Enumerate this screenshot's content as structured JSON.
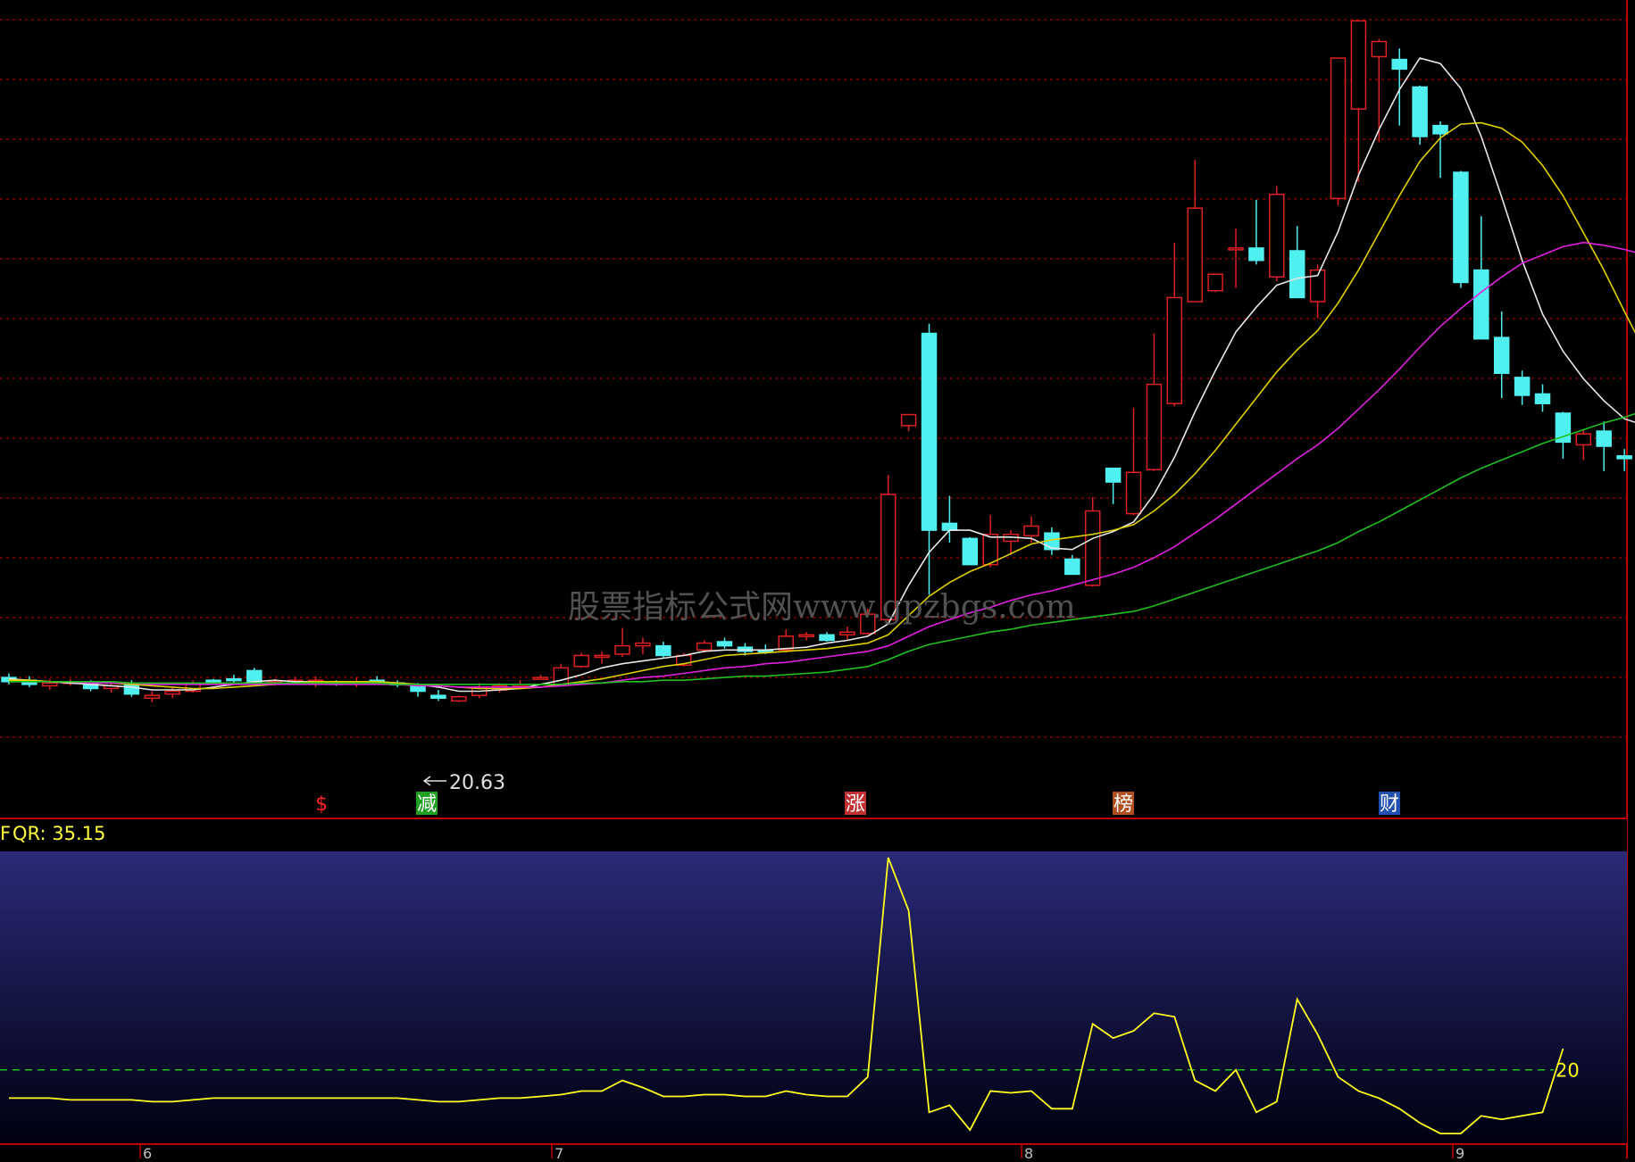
{
  "colors": {
    "background": "#000000",
    "grid": "#a00000",
    "frame": "#c00000",
    "up": "#e02020",
    "down": "#50f0f0",
    "ma_white": "#e8e8e8",
    "ma_yellow": "#e0d000",
    "ma_magenta": "#e020e0",
    "ma_green": "#20c020",
    "qr_line": "#ffff20",
    "qr_ref": "#20c020",
    "panel_top": "#2a2a78",
    "panel_bottom": "#000010"
  },
  "watermark": "股票指标公式网www.gpzbgs.com",
  "price_panel": {
    "low_marker_label": "20.63",
    "event_labels": [
      {
        "text": "$",
        "color": "#ff2020",
        "bg": "#000000"
      },
      {
        "text": "减",
        "color": "#ffffff",
        "bg": "#20a020"
      },
      {
        "text": "涨",
        "color": "#ffffff",
        "bg": "#c03030"
      },
      {
        "text": "榜",
        "color": "#ffffff",
        "bg": "#b05020"
      },
      {
        "text": "财",
        "color": "#ffffff",
        "bg": "#2050b0"
      }
    ]
  },
  "indicator_panel": {
    "label": "QR: 35.15",
    "ref_label": "20"
  },
  "x_axis": {
    "labels": [
      "6",
      "7",
      "8",
      "9"
    ]
  },
  "chart_data": {
    "type": "candlestick",
    "candles": [
      {
        "o": 27.3,
        "h": 27.6,
        "l": 26.8,
        "c": 27.0
      },
      {
        "o": 27.1,
        "h": 27.4,
        "l": 26.6,
        "c": 26.8
      },
      {
        "o": 26.7,
        "h": 27.2,
        "l": 26.4,
        "c": 26.9
      },
      {
        "o": 27.0,
        "h": 27.2,
        "l": 26.7,
        "c": 27.0
      },
      {
        "o": 26.9,
        "h": 27.1,
        "l": 26.3,
        "c": 26.5
      },
      {
        "o": 26.5,
        "h": 27.0,
        "l": 26.2,
        "c": 26.7
      },
      {
        "o": 26.9,
        "h": 27.1,
        "l": 25.9,
        "c": 26.1
      },
      {
        "o": 25.8,
        "h": 26.3,
        "l": 25.5,
        "c": 26.0
      },
      {
        "o": 26.1,
        "h": 26.6,
        "l": 25.8,
        "c": 26.3
      },
      {
        "o": 26.3,
        "h": 27.1,
        "l": 26.2,
        "c": 26.9
      },
      {
        "o": 27.1,
        "h": 27.2,
        "l": 26.9,
        "c": 27.0
      },
      {
        "o": 27.2,
        "h": 27.5,
        "l": 26.9,
        "c": 27.1
      },
      {
        "o": 27.8,
        "h": 28.0,
        "l": 26.9,
        "c": 27.0
      },
      {
        "o": 26.9,
        "h": 27.2,
        "l": 26.7,
        "c": 27.0
      },
      {
        "o": 26.9,
        "h": 27.3,
        "l": 26.8,
        "c": 27.1
      },
      {
        "o": 27.0,
        "h": 27.4,
        "l": 26.6,
        "c": 27.1
      },
      {
        "o": 27.0,
        "h": 27.1,
        "l": 26.7,
        "c": 26.8
      },
      {
        "o": 26.8,
        "h": 27.3,
        "l": 26.6,
        "c": 27.0
      },
      {
        "o": 27.1,
        "h": 27.4,
        "l": 26.8,
        "c": 26.9
      },
      {
        "o": 26.9,
        "h": 27.1,
        "l": 26.6,
        "c": 26.8
      },
      {
        "o": 26.7,
        "h": 26.9,
        "l": 25.9,
        "c": 26.3
      },
      {
        "o": 26.0,
        "h": 26.4,
        "l": 25.6,
        "c": 25.8
      },
      {
        "o": 25.6,
        "h": 26.0,
        "l": 25.5,
        "c": 25.9
      },
      {
        "o": 26.0,
        "h": 26.9,
        "l": 25.8,
        "c": 26.6
      },
      {
        "o": 26.4,
        "h": 26.9,
        "l": 26.2,
        "c": 26.7
      },
      {
        "o": 26.7,
        "h": 27.1,
        "l": 26.5,
        "c": 26.8
      },
      {
        "o": 27.2,
        "h": 27.5,
        "l": 27.1,
        "c": 27.3
      },
      {
        "o": 26.8,
        "h": 28.3,
        "l": 26.8,
        "c": 28.0
      },
      {
        "o": 28.1,
        "h": 29.1,
        "l": 28.0,
        "c": 28.9
      },
      {
        "o": 28.8,
        "h": 29.2,
        "l": 28.3,
        "c": 28.9
      },
      {
        "o": 29.0,
        "h": 30.9,
        "l": 28.8,
        "c": 29.6
      },
      {
        "o": 29.6,
        "h": 30.2,
        "l": 29.0,
        "c": 29.8
      },
      {
        "o": 29.6,
        "h": 29.9,
        "l": 28.7,
        "c": 28.9
      },
      {
        "o": 28.2,
        "h": 29.1,
        "l": 28.1,
        "c": 28.9
      },
      {
        "o": 29.3,
        "h": 30.0,
        "l": 29.1,
        "c": 29.8
      },
      {
        "o": 29.9,
        "h": 30.2,
        "l": 29.4,
        "c": 29.6
      },
      {
        "o": 29.5,
        "h": 29.8,
        "l": 28.9,
        "c": 29.2
      },
      {
        "o": 29.3,
        "h": 29.7,
        "l": 29.0,
        "c": 29.2
      },
      {
        "o": 29.3,
        "h": 30.8,
        "l": 29.1,
        "c": 30.3
      },
      {
        "o": 30.3,
        "h": 30.6,
        "l": 30.0,
        "c": 30.4
      },
      {
        "o": 30.4,
        "h": 30.6,
        "l": 29.9,
        "c": 30.0
      },
      {
        "o": 30.4,
        "h": 31.0,
        "l": 30.0,
        "c": 30.6
      },
      {
        "o": 30.5,
        "h": 32.3,
        "l": 30.4,
        "c": 31.9
      },
      {
        "o": 31.5,
        "h": 42.0,
        "l": 31.4,
        "c": 40.6
      },
      {
        "o": 45.6,
        "h": 46.4,
        "l": 45.2,
        "c": 46.4
      },
      {
        "o": 52.3,
        "h": 53.0,
        "l": 33.3,
        "c": 38.0
      },
      {
        "o": 38.5,
        "h": 40.5,
        "l": 37.1,
        "c": 38.0
      },
      {
        "o": 37.4,
        "h": 37.5,
        "l": 35.5,
        "c": 35.5
      },
      {
        "o": 35.5,
        "h": 39.1,
        "l": 35.3,
        "c": 37.7
      },
      {
        "o": 37.2,
        "h": 38.0,
        "l": 36.2,
        "c": 37.7
      },
      {
        "o": 37.6,
        "h": 39.0,
        "l": 37.1,
        "c": 38.3
      },
      {
        "o": 37.8,
        "h": 38.2,
        "l": 36.2,
        "c": 36.6
      },
      {
        "o": 35.9,
        "h": 36.2,
        "l": 34.8,
        "c": 34.8
      },
      {
        "o": 34.0,
        "h": 40.4,
        "l": 33.9,
        "c": 39.4
      },
      {
        "o": 42.5,
        "h": 42.5,
        "l": 39.9,
        "c": 41.5
      },
      {
        "o": 39.2,
        "h": 46.9,
        "l": 39.1,
        "c": 42.2
      },
      {
        "o": 42.4,
        "h": 52.3,
        "l": 42.3,
        "c": 48.6
      },
      {
        "o": 47.2,
        "h": 58.9,
        "l": 47.0,
        "c": 54.9
      },
      {
        "o": 54.6,
        "h": 64.9,
        "l": 54.6,
        "c": 61.4
      },
      {
        "o": 55.4,
        "h": 56.4,
        "l": 55.3,
        "c": 56.6
      },
      {
        "o": 58.5,
        "h": 59.9,
        "l": 55.6,
        "c": 58.5
      },
      {
        "o": 58.5,
        "h": 62.0,
        "l": 57.3,
        "c": 57.6
      },
      {
        "o": 56.4,
        "h": 63.0,
        "l": 56.1,
        "c": 62.4
      },
      {
        "o": 58.3,
        "h": 60.1,
        "l": 54.9,
        "c": 54.9
      },
      {
        "o": 54.6,
        "h": 57.3,
        "l": 53.4,
        "c": 56.9
      },
      {
        "o": 62.1,
        "h": 72.3,
        "l": 61.6,
        "c": 72.3
      },
      {
        "o": 68.6,
        "h": 75.0,
        "l": 63.3,
        "c": 75.0
      },
      {
        "o": 72.4,
        "h": 73.7,
        "l": 66.2,
        "c": 73.5
      },
      {
        "o": 72.2,
        "h": 73.0,
        "l": 67.4,
        "c": 71.5
      },
      {
        "o": 70.2,
        "h": 70.3,
        "l": 66.0,
        "c": 66.6
      },
      {
        "o": 67.4,
        "h": 67.7,
        "l": 63.6,
        "c": 66.8
      },
      {
        "o": 64.0,
        "h": 64.1,
        "l": 55.6,
        "c": 56.0
      },
      {
        "o": 56.9,
        "h": 60.8,
        "l": 51.9,
        "c": 51.9
      },
      {
        "o": 52.0,
        "h": 53.9,
        "l": 47.6,
        "c": 49.4
      },
      {
        "o": 49.1,
        "h": 49.6,
        "l": 47.1,
        "c": 47.8
      },
      {
        "o": 47.9,
        "h": 48.6,
        "l": 46.6,
        "c": 47.2
      },
      {
        "o": 46.5,
        "h": 46.6,
        "l": 43.2,
        "c": 44.4
      },
      {
        "o": 44.2,
        "h": 45.3,
        "l": 43.1,
        "c": 45.0
      },
      {
        "o": 45.2,
        "h": 45.9,
        "l": 42.3,
        "c": 44.1
      },
      {
        "o": 43.4,
        "h": 43.9,
        "l": 42.3,
        "c": 43.2
      },
      {
        "o": 44.2,
        "h": 52.0,
        "l": 44.2,
        "c": 50.6
      }
    ],
    "moving_averages": [
      {
        "color": "#e8e8e8",
        "values": [
          27.2,
          27.1,
          27.0,
          26.9,
          26.8,
          26.7,
          26.6,
          26.4,
          26.4,
          26.4,
          26.6,
          26.8,
          27.0,
          27.1,
          27.0,
          27.0,
          27.0,
          27.0,
          27.0,
          26.9,
          26.8,
          26.6,
          26.3,
          26.3,
          26.4,
          26.5,
          26.8,
          27.1,
          27.5,
          28.0,
          28.3,
          28.5,
          28.7,
          28.9,
          29.2,
          29.3,
          29.3,
          29.3,
          29.4,
          29.5,
          29.8,
          30.0,
          30.3,
          31.2,
          34.0,
          36.4,
          38.0,
          38.0,
          37.5,
          37.5,
          37.4,
          36.7,
          36.6,
          37.4,
          37.9,
          38.6,
          40.6,
          43.3,
          46.6,
          49.6,
          52.4,
          54.2,
          55.8,
          56.3,
          56.5,
          59.7,
          63.8,
          67.1,
          70.0,
          72.3,
          71.9,
          70.1,
          66.6,
          62.2,
          57.6,
          53.7,
          51.0,
          49.0,
          47.4,
          46.1,
          45.6,
          45.9
        ]
      },
      {
        "color": "#e0d000",
        "values": [
          27.1,
          27.1,
          27.0,
          27.0,
          26.9,
          26.9,
          26.8,
          26.7,
          26.6,
          26.5,
          26.5,
          26.6,
          26.7,
          26.8,
          26.9,
          27.0,
          27.0,
          27.0,
          27.0,
          26.9,
          26.8,
          26.7,
          26.6,
          26.5,
          26.5,
          26.5,
          26.6,
          26.8,
          27.0,
          27.2,
          27.5,
          27.8,
          28.1,
          28.3,
          28.6,
          28.9,
          29.0,
          29.1,
          29.2,
          29.3,
          29.4,
          29.6,
          29.8,
          30.4,
          31.8,
          33.2,
          34.2,
          35.0,
          35.6,
          36.3,
          37.0,
          37.3,
          37.5,
          37.7,
          38.0,
          38.4,
          39.4,
          40.6,
          42.1,
          43.8,
          45.7,
          47.6,
          49.5,
          51.1,
          52.5,
          54.5,
          56.9,
          59.6,
          62.3,
          64.8,
          66.5,
          67.5,
          67.6,
          67.2,
          66.2,
          64.5,
          62.3,
          59.6,
          56.9,
          53.9,
          51.0,
          49.0
        ]
      },
      {
        "color": "#e020e0",
        "values": [
          27.0,
          27.0,
          27.0,
          27.0,
          26.9,
          26.9,
          26.9,
          26.8,
          26.8,
          26.8,
          26.8,
          26.8,
          26.8,
          26.8,
          26.8,
          26.8,
          26.8,
          26.8,
          26.8,
          26.8,
          26.7,
          26.7,
          26.6,
          26.6,
          26.6,
          26.6,
          26.6,
          26.7,
          26.8,
          26.9,
          27.1,
          27.3,
          27.4,
          27.6,
          27.8,
          28.0,
          28.1,
          28.3,
          28.4,
          28.6,
          28.8,
          29.0,
          29.2,
          29.6,
          30.3,
          31.0,
          31.5,
          32.0,
          32.4,
          32.9,
          33.3,
          33.6,
          34.0,
          34.4,
          34.8,
          35.3,
          36.0,
          36.8,
          37.8,
          38.8,
          39.9,
          41.0,
          42.1,
          43.2,
          44.2,
          45.4,
          46.8,
          48.2,
          49.7,
          51.3,
          52.8,
          54.1,
          55.3,
          56.4,
          57.4,
          58.0,
          58.6,
          58.9,
          58.7,
          58.4,
          58.0,
          57.8
        ]
      },
      {
        "color": "#20c020",
        "values": [
          27.0,
          27.0,
          27.0,
          27.0,
          27.0,
          27.0,
          26.9,
          26.9,
          26.9,
          26.9,
          26.9,
          26.9,
          26.9,
          26.9,
          26.9,
          26.9,
          26.9,
          26.9,
          26.9,
          26.8,
          26.8,
          26.8,
          26.8,
          26.8,
          26.8,
          26.8,
          26.8,
          26.8,
          26.9,
          26.9,
          27.0,
          27.0,
          27.1,
          27.1,
          27.2,
          27.3,
          27.4,
          27.4,
          27.5,
          27.6,
          27.7,
          27.9,
          28.1,
          28.6,
          29.2,
          29.7,
          30.0,
          30.3,
          30.6,
          30.8,
          31.1,
          31.3,
          31.5,
          31.7,
          31.9,
          32.1,
          32.5,
          33.0,
          33.5,
          34.0,
          34.5,
          35.0,
          35.5,
          36.0,
          36.5,
          37.1,
          37.9,
          38.6,
          39.4,
          40.2,
          41.0,
          41.8,
          42.5,
          43.1,
          43.7,
          44.3,
          44.8,
          45.3,
          45.8,
          46.2,
          46.7,
          47.4
        ]
      }
    ],
    "qr": {
      "name": "QR",
      "values": [
        12,
        12,
        12,
        11.5,
        11.5,
        11.5,
        11.5,
        11,
        11,
        11.5,
        12,
        12,
        12,
        12,
        12,
        12,
        12,
        12,
        12,
        12,
        11.5,
        11,
        11,
        11.5,
        12,
        12,
        12.5,
        13,
        14,
        14,
        17,
        15,
        12.5,
        12.5,
        13,
        13,
        12.5,
        12.5,
        14,
        13,
        12.5,
        12.5,
        18,
        80,
        65,
        8,
        10,
        3,
        14,
        13.5,
        14,
        9,
        9,
        33,
        29,
        31,
        36,
        35,
        17,
        14,
        20,
        8,
        11,
        40,
        30,
        18,
        14,
        12,
        9,
        5,
        2,
        2,
        7,
        6,
        7,
        8,
        26
      ],
      "reference": 20,
      "last": 35.15
    },
    "y_price_range": [
      20.63,
      76.0
    ],
    "y_qr_range": [
      0,
      81
    ]
  }
}
